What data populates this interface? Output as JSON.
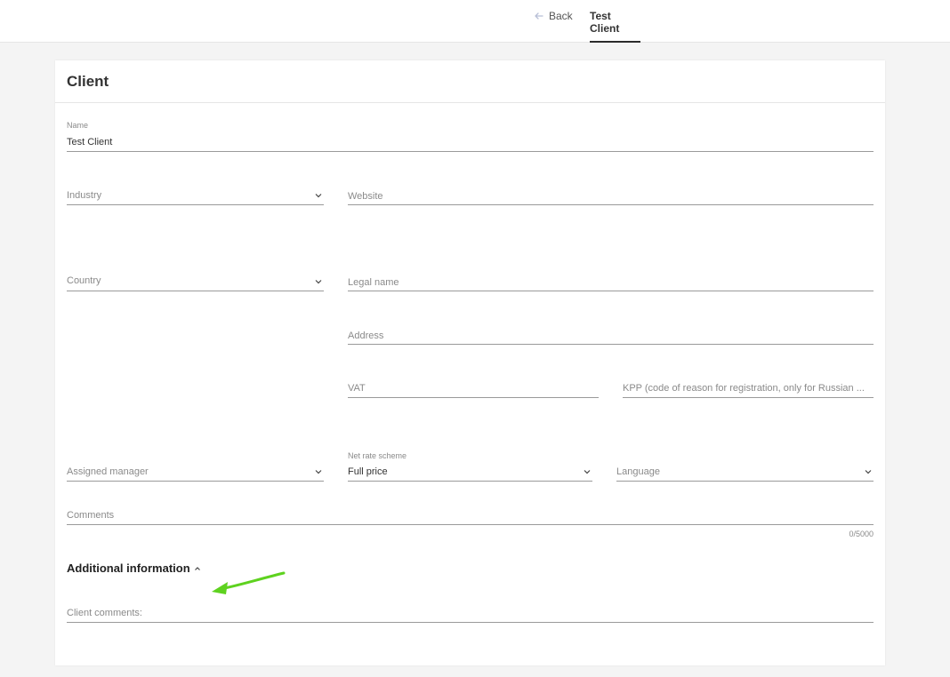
{
  "header": {
    "back_label": "Back",
    "tab_label": "Test Client"
  },
  "card": {
    "title": "Client",
    "name_label": "Name",
    "name_value": "Test Client",
    "industry_placeholder": "Industry",
    "website_placeholder": "Website",
    "country_placeholder": "Country",
    "legal_name_placeholder": "Legal name",
    "address_placeholder": "Address",
    "vat_placeholder": "VAT",
    "kpp_placeholder": "KPP (code of reason for registration, only for Russian ...",
    "assigned_manager_placeholder": "Assigned manager",
    "net_rate_label": "Net rate scheme",
    "net_rate_value": "Full price",
    "language_placeholder": "Language",
    "comments_placeholder": "Comments",
    "comments_counter": "0/5000",
    "additional_info_title": "Additional information",
    "client_comments_placeholder": "Client comments:"
  },
  "icons": {
    "back": "arrow-left-icon",
    "dropdown": "chevron-down-icon",
    "collapse": "chevron-up-icon"
  },
  "colors": {
    "annotation_arrow": "#5ed21f",
    "tab_underline": "#2b2b2b"
  }
}
